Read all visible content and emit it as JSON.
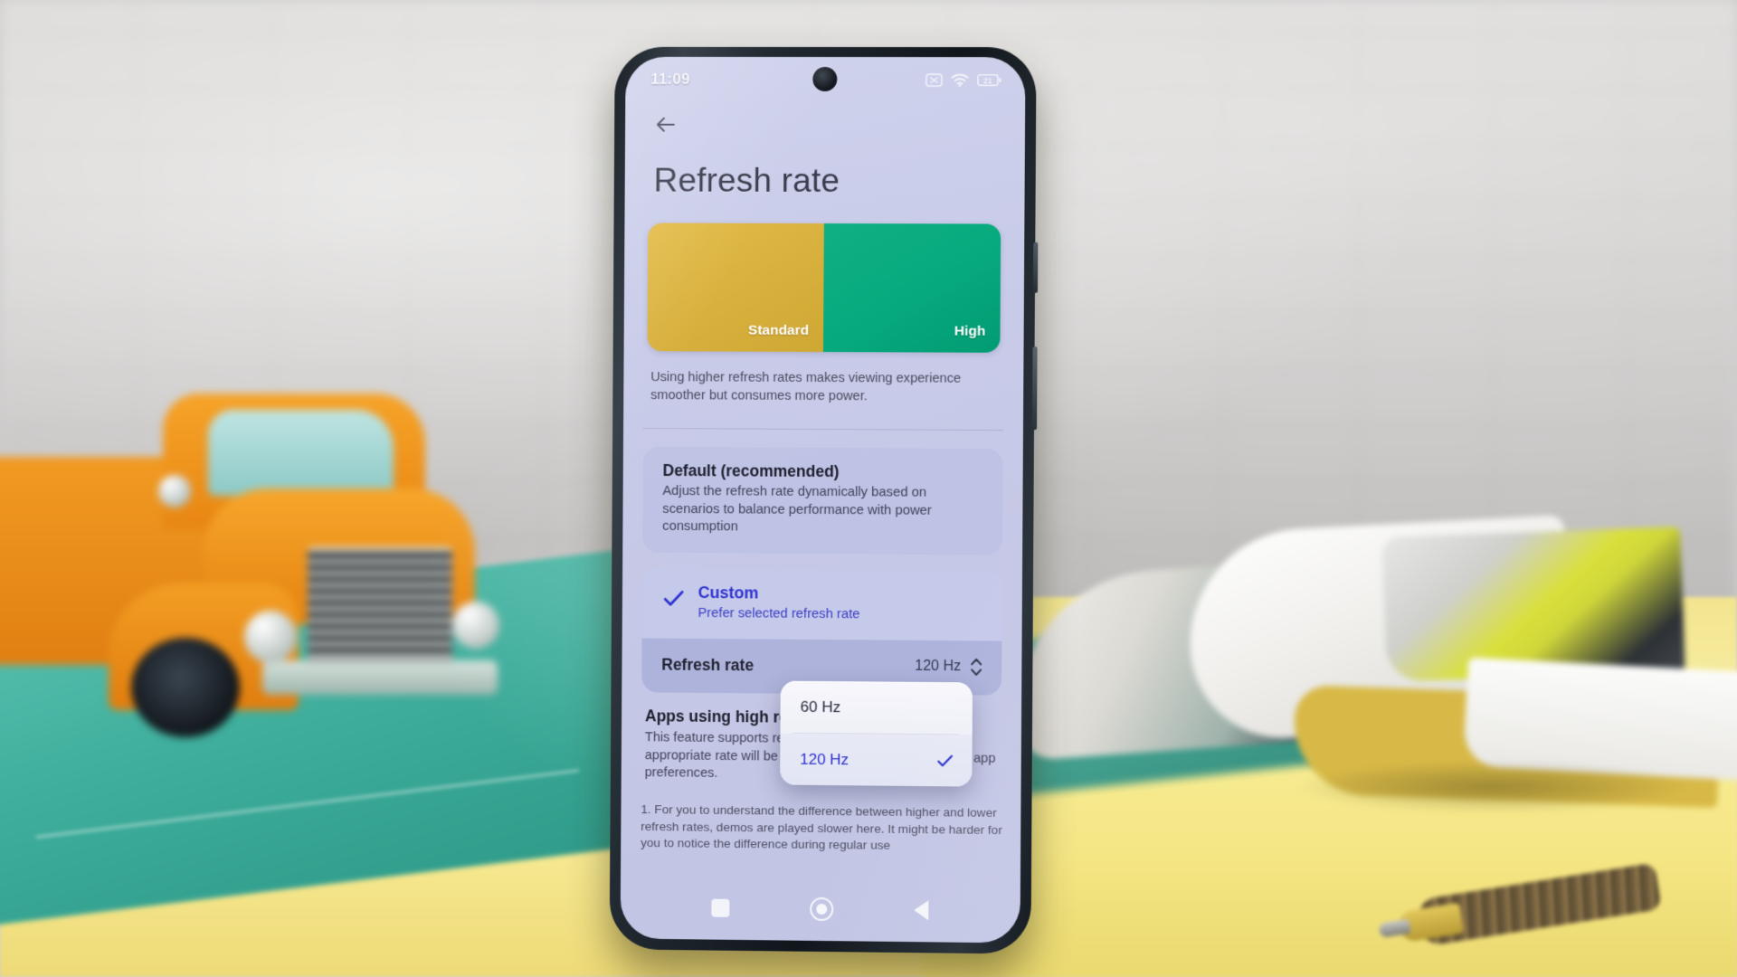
{
  "scene": {
    "description": "Smartphone standing on a yellow desk with a teal cutting mat, an orange toy pickup truck on the left, an open magazine and a wooden pen on the right, blurred grey brick wall behind"
  },
  "phone": {
    "statusbar": {
      "time": "11:09",
      "icons": [
        {
          "name": "no-sim-icon",
          "glyph": "x-in-box"
        },
        {
          "name": "wifi-icon",
          "glyph": "wifi"
        },
        {
          "name": "battery-icon",
          "glyph": "battery",
          "level": "21"
        }
      ]
    },
    "navigation": {
      "back_label": "Back",
      "recents_label": "Recents",
      "home_label": "Home"
    },
    "screen": {
      "back_button_label": "Back",
      "title": "Refresh rate",
      "demo": {
        "standard_label": "Standard",
        "high_label": "High",
        "standard_color": "#d9b13e",
        "high_color": "#06a97d"
      },
      "banner_note": "Using higher refresh rates makes viewing experience smoother but consumes more power.",
      "options": [
        {
          "id": "default",
          "title": "Default (recommended)",
          "description": "Adjust the refresh rate dynamically based on scenarios to balance performance with power consumption",
          "selected": false
        },
        {
          "id": "custom",
          "title": "Custom",
          "description": "Prefer selected refresh rate",
          "selected": true
        }
      ],
      "rate_row": {
        "label": "Refresh rate",
        "value": "120 Hz"
      },
      "dropdown": {
        "items": [
          {
            "label": "60 Hz",
            "selected": false
          },
          {
            "label": "120 Hz",
            "selected": true
          }
        ]
      },
      "apps_section": {
        "title": "Apps using high refresh rate",
        "description": "This feature supports refresh rates up to 120 Hz. The appropriate rate will be automatically selected based on app preferences."
      },
      "footnote": "1. For you to understand the difference between higher and lower refresh rates, demos are played slower here. It might be harder for you to notice the difference during regular use",
      "accent_color": "#2f33cf"
    }
  }
}
